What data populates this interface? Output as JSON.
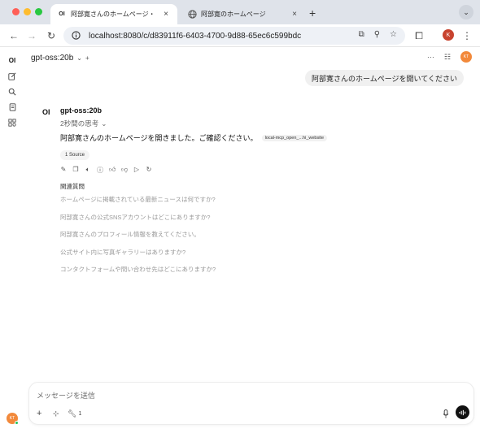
{
  "browser": {
    "tabs": [
      {
        "favicon": "OI",
        "title": "阿部寛さんのホームページ・",
        "active": true
      },
      {
        "favicon": "globe-icon",
        "title": "阿部寛のホームページ",
        "active": false
      }
    ],
    "url": "localhost:8080/c/d83911f6-6403-4700-9d88-65ec6c599bdc",
    "profile_initial": "K"
  },
  "app": {
    "logo": "OI",
    "model": "gpt-oss:20b",
    "user_initials": "KT",
    "user_message": "阿部寛さんのホームページを開いてください",
    "assistant": {
      "name": "gpt-oss:20b",
      "thinking_label": "2秒間の思考",
      "reply": "阿部寛さんのホームページを開きました。ご確認ください。",
      "tool_chip": "local-mcp_open_...hi_website",
      "sources_label": "1 Source"
    },
    "related": {
      "title": "関連質問",
      "questions": [
        "ホームページに掲載されている最新ニュースは何ですか?",
        "阿部寛さんの公式SNSアカウントはどこにありますか?",
        "阿部寛さんのプロフィール情報を教えてください。",
        "公式サイト内に写真ギャラリーはありますか?",
        "コンタクトフォームや問い合わせ先はどこにありますか?"
      ]
    },
    "composer": {
      "placeholder": "メッセージを送信",
      "tools_count": "1"
    }
  }
}
